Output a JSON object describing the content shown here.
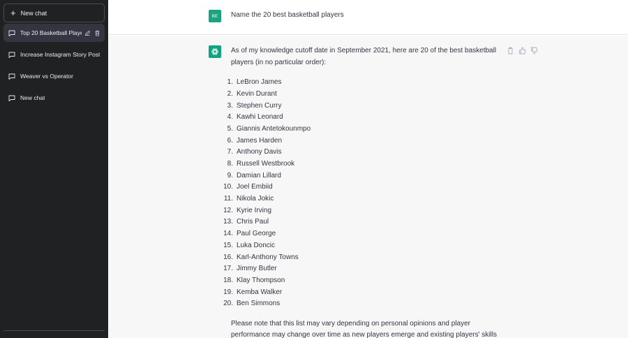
{
  "sidebar": {
    "new_chat_label": "New chat",
    "conversations": [
      {
        "label": "Top 20 Basketball Playe",
        "active": true
      },
      {
        "label": "Increase Instagram Story Post"
      },
      {
        "label": "Weaver vs Operator"
      },
      {
        "label": "New chat"
      }
    ]
  },
  "user": {
    "avatar_initials": "BE",
    "message": "Name the 20 best basketball players"
  },
  "assistant": {
    "intro": "As of my knowledge cutoff date in September 2021, here are 20 of the best basketball players (in no particular order):",
    "players": [
      "LeBron James",
      "Kevin Durant",
      "Stephen Curry",
      "Kawhi Leonard",
      "Giannis Antetokounmpo",
      "James Harden",
      "Anthony Davis",
      "Russell Westbrook",
      "Damian Lillard",
      "Joel Embiid",
      "Nikola Jokic",
      "Kyrie Irving",
      "Chris Paul",
      "Paul George",
      "Luka Doncic",
      "Karl-Anthony Towns",
      "Jimmy Butler",
      "Klay Thompson",
      "Kemba Walker",
      "Ben Simmons"
    ],
    "note": "Please note that this list may vary depending on personal opinions and player performance may change over time as new players emerge and existing players' skills evolve."
  },
  "colors": {
    "sidebar_bg": "#202123",
    "active_item_bg": "#343541",
    "user_avatar": "#19a37f",
    "assistant_avatar": "#10a37f",
    "assistant_row_bg": "#f7f7f8"
  },
  "icons": {
    "new_chat": "plus-icon",
    "conversation": "chat-bubble-icon",
    "edit": "pencil-icon",
    "delete": "trash-icon",
    "assistant": "openai-logo-icon",
    "copy": "clipboard-icon",
    "like": "thumbs-up-icon",
    "dislike": "thumbs-down-icon"
  }
}
